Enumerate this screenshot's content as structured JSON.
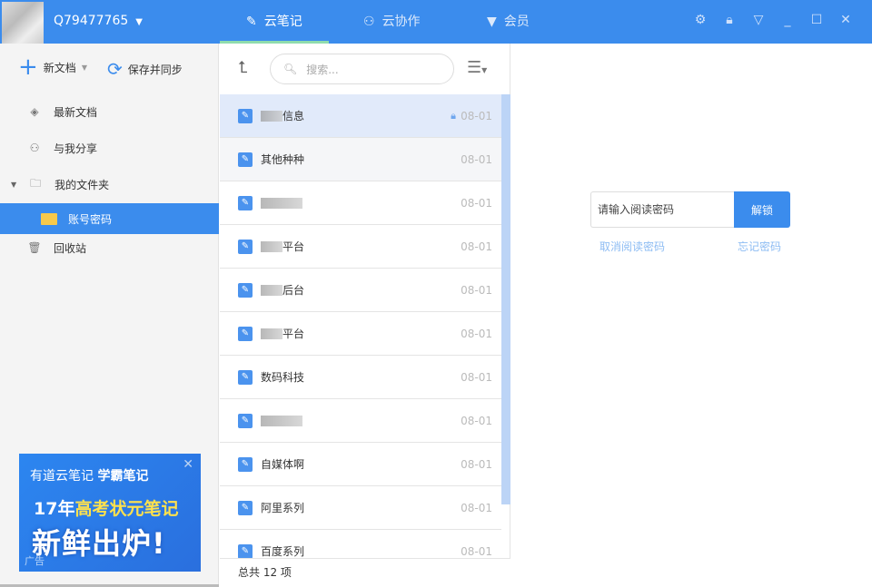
{
  "header": {
    "username": "Q79477765",
    "tabs": [
      {
        "label": "云笔记",
        "icon": "pen-icon",
        "active": true
      },
      {
        "label": "云协作",
        "icon": "users-icon"
      },
      {
        "label": "会员",
        "icon": "vip-diamond-icon"
      }
    ],
    "window_buttons": [
      "gear-icon",
      "lock-icon",
      "dropdown-icon",
      "minimize-icon",
      "maximize-icon",
      "close-icon"
    ]
  },
  "sidebar": {
    "new_doc": "新文档",
    "save_sync": "保存并同步",
    "items": [
      {
        "label": "最新文档",
        "icon": "layers-icon"
      },
      {
        "label": "与我分享",
        "icon": "share-user-icon"
      },
      {
        "label": "我的文件夹",
        "icon": "folder-icon"
      },
      {
        "label": "账号密码",
        "icon": "folder-icon",
        "selected": true
      },
      {
        "label": "回收站",
        "icon": "trash-icon"
      }
    ],
    "ad": {
      "brand": "有道云笔记",
      "slogan": "学霸笔记",
      "line2_prefix": "17年",
      "line2_highlight": "高考状元笔记",
      "line3": "新鲜出炉!",
      "tag": "广告"
    }
  },
  "list": {
    "search_placeholder": "搜索...",
    "notes": [
      {
        "title": "信息",
        "date": "08-01",
        "blurred": true,
        "locked": true
      },
      {
        "title": "其他种种",
        "date": "08-01"
      },
      {
        "title": "",
        "date": "08-01",
        "blurred": true
      },
      {
        "title": "平台",
        "date": "08-01",
        "blurred": true
      },
      {
        "title": "后台",
        "date": "08-01",
        "blurred": true
      },
      {
        "title": "平台",
        "date": "08-01",
        "blurred": true
      },
      {
        "title": "数码科技",
        "date": "08-01"
      },
      {
        "title": "",
        "date": "08-01",
        "blurred": true
      },
      {
        "title": "自媒体啊",
        "date": "08-01"
      },
      {
        "title": "阿里系列",
        "date": "08-01"
      },
      {
        "title": "百度系列",
        "date": "08-01"
      }
    ],
    "footer": "总共 12 项"
  },
  "lock_panel": {
    "placeholder": "请输入阅读密码",
    "unlock": "解锁",
    "cancel": "取消阅读密码",
    "forgot": "忘记密码"
  },
  "colors": {
    "accent": "#3b8ced",
    "selected_row": "#e1eafa",
    "tab_indicator": "#8fdcae"
  }
}
